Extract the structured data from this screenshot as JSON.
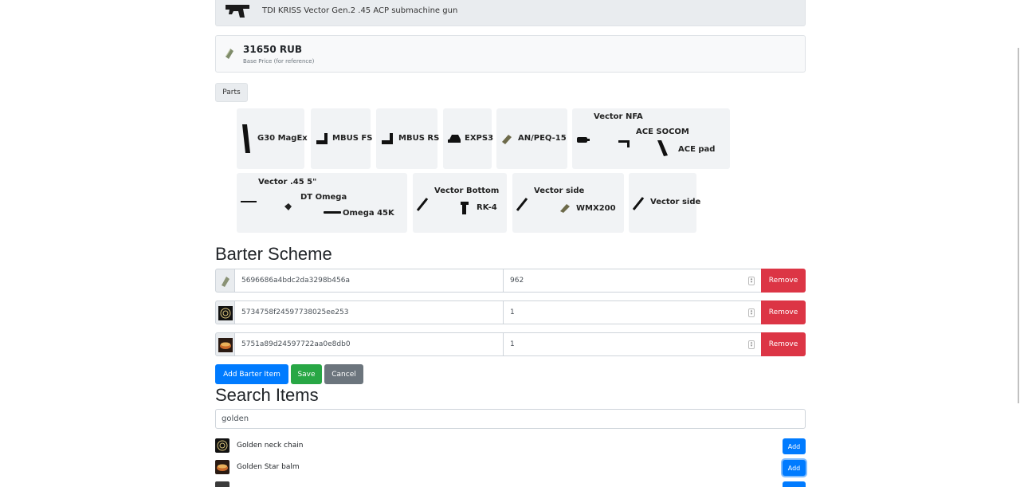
{
  "item": {
    "name": "TDI KRISS Vector Gen.2 .45 ACP submachine gun",
    "icon": "gun-icon"
  },
  "price": {
    "value": "31650 RUB",
    "label": "Base Price (for reference)",
    "icon": "cash-icon"
  },
  "parts_button": "Parts",
  "parts": {
    "p1": "G30 MagEx",
    "p2": "MBUS FS",
    "p3": "MBUS RS",
    "p4": "EXPS3",
    "p5": "AN/PEQ-15",
    "p6_title": "Vector NFA",
    "p6_sub1": "ACE SOCOM",
    "p6_sub2": "ACE pad",
    "p7_title": "Vector .45 5\"",
    "p7_sub1": "DT Omega",
    "p7_sub2": "Omega 45K",
    "p8_title": "Vector Bottom",
    "p8_sub1": "RK-4",
    "p9_title": "Vector side",
    "p9_sub1": "WMX200",
    "p10": "Vector side"
  },
  "barter": {
    "title": "Barter Scheme",
    "rows": [
      {
        "id": "5696686a4bdc2da3298b456a",
        "qty": "962",
        "remove": "Remove",
        "icon": "dollar-bills-icon"
      },
      {
        "id": "5734758f24597738025ee253",
        "qty": "1",
        "remove": "Remove",
        "icon": "golden-neck-chain-icon"
      },
      {
        "id": "5751a89d24597722aa0e8db0",
        "qty": "1",
        "remove": "Remove",
        "icon": "golden-star-balm-icon"
      }
    ],
    "add_label": "Add Barter Item",
    "save_label": "Save",
    "cancel_label": "Cancel"
  },
  "search": {
    "title": "Search Items",
    "value": "golden",
    "results": [
      {
        "name": "Golden neck chain",
        "add": "Add",
        "icon": "golden-neck-chain-icon"
      },
      {
        "name": "Golden Star balm",
        "add": "Add",
        "icon": "golden-star-balm-icon"
      },
      {
        "name": "",
        "add": "",
        "icon": "item-icon"
      }
    ]
  },
  "colors": {
    "primary": "#007bff",
    "success": "#28a745",
    "danger": "#dc3545",
    "secondary": "#6c757d"
  }
}
